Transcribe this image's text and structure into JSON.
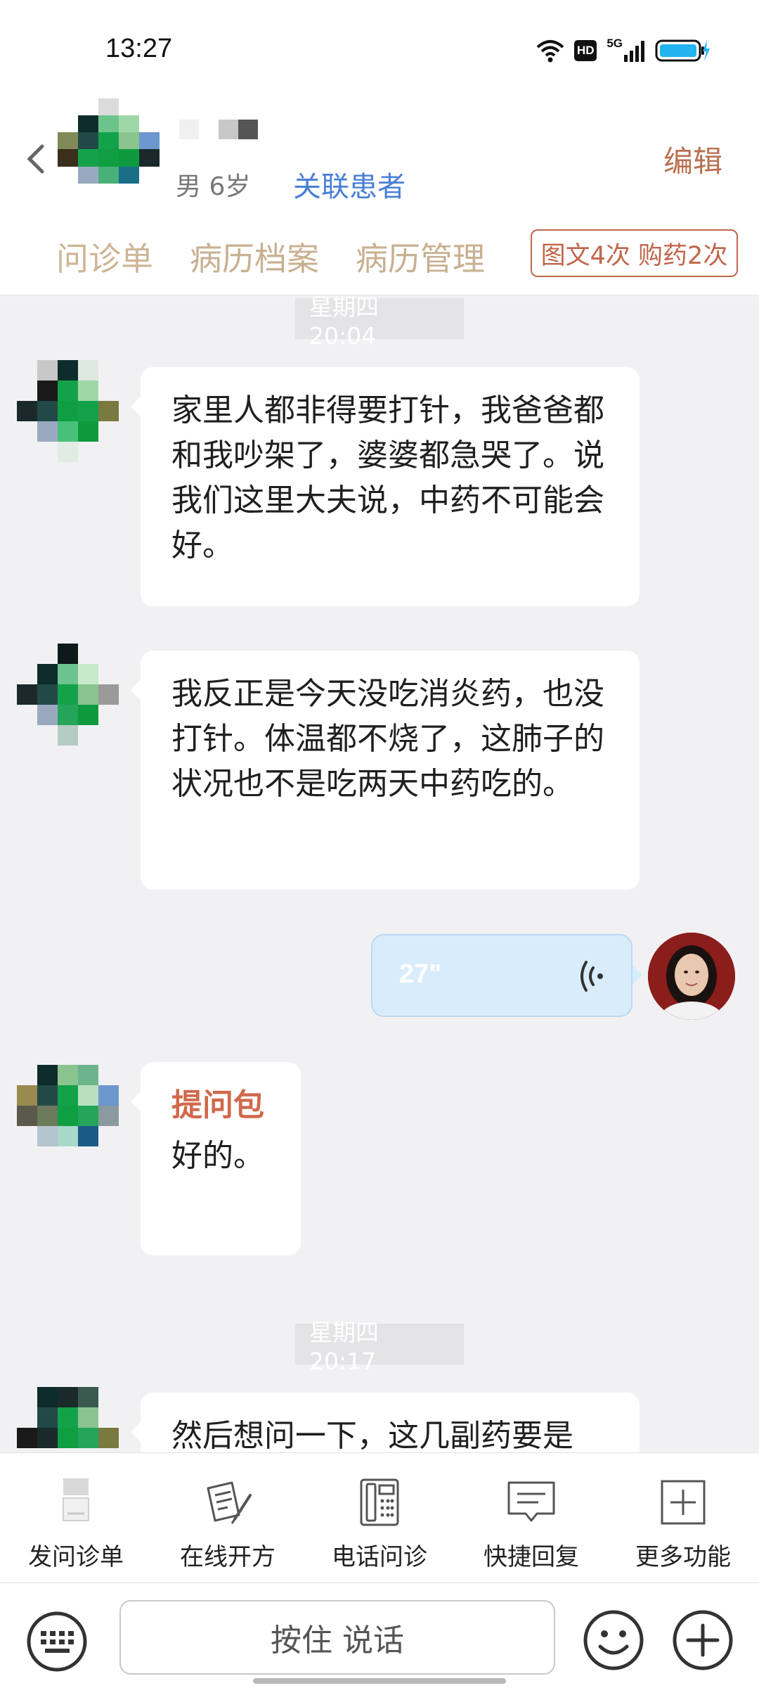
{
  "status_bar": {
    "time": "13:27",
    "hd": "HD",
    "network": "5G"
  },
  "header": {
    "patient_info": "男 6岁",
    "link_patient": "关联患者",
    "edit": "编辑",
    "tabs": [
      "问诊单",
      "病历档案",
      "病历管理"
    ],
    "quota": "图文4次 购药2次"
  },
  "chat": {
    "time_1": "星期四 20:04",
    "msg_1": "家里人都非得要打针，我爸爸都和我吵架了，婆婆都急哭了。说我们这里大夫说，中药不可能会好。",
    "msg_2": "我反正是今天没吃消炎药，也没打针。体温都不烧了，这肺子的状况也不是吃两天中药吃的。",
    "voice_duration": "27\"",
    "pkg_title": "提问包",
    "msg_3": "好的。",
    "time_2": "星期四 20:17",
    "msg_4": "然后想问一下，这几副药要是"
  },
  "toolbar": {
    "items": [
      {
        "label": "发问诊单",
        "icon": "inquiry-form-icon"
      },
      {
        "label": "在线开方",
        "icon": "prescription-icon"
      },
      {
        "label": "电话问诊",
        "icon": "phone-icon"
      },
      {
        "label": "快捷回复",
        "icon": "quick-reply-icon"
      },
      {
        "label": "更多功能",
        "icon": "more-icon"
      }
    ]
  },
  "input_bar": {
    "hold_to_talk": "按住 说话"
  }
}
